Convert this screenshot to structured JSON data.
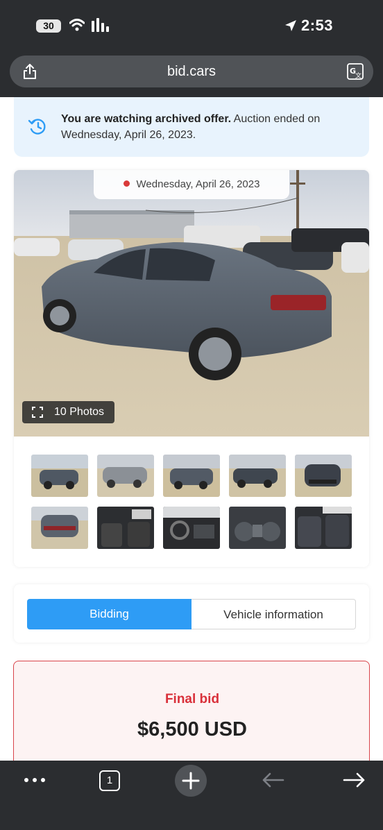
{
  "status_bar": {
    "battery": "30",
    "time": "2:53"
  },
  "address_bar": {
    "url": "bid.cars"
  },
  "banner": {
    "bold_text": "You are watching archived offer.",
    "text": " Auction ended on Wednesday, April 26, 2023."
  },
  "gallery": {
    "date": "Wednesday, April 26, 2023",
    "photos_label": "10 Photos",
    "thumbnail_count": 10
  },
  "tabs": {
    "bidding": "Bidding",
    "vehicle_information": "Vehicle information"
  },
  "bid": {
    "label": "Final bid",
    "amount": "$6,500 USD"
  },
  "toolbar": {
    "tab_count": "1"
  },
  "colors": {
    "accent_blue": "#2e9cf5",
    "bid_red": "#d9303a",
    "banner_bg": "#e8f3fd"
  }
}
